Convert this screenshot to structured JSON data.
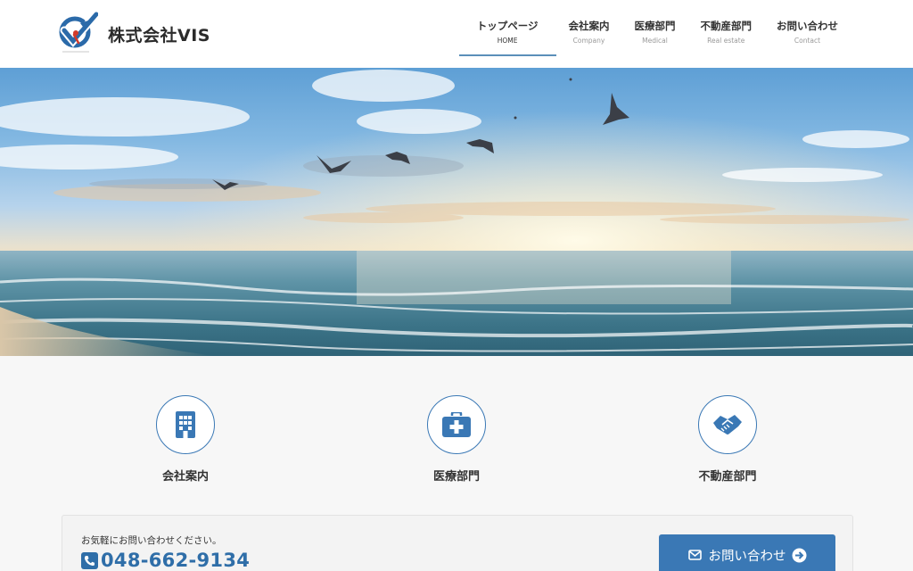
{
  "header": {
    "company_name": "株式会社VIS",
    "nav": [
      {
        "jp": "トップページ",
        "en": "HOME",
        "active": true
      },
      {
        "jp": "会社案内",
        "en": "Company"
      },
      {
        "jp": "医療部門",
        "en": "Medical"
      },
      {
        "jp": "不動産部門",
        "en": "Real estate"
      },
      {
        "jp": "お問い合わせ",
        "en": "Contact"
      }
    ]
  },
  "features": [
    {
      "label": "会社案内",
      "icon": "building-icon"
    },
    {
      "label": "医療部門",
      "icon": "medical-kit-icon"
    },
    {
      "label": "不動産部門",
      "icon": "handshake-icon"
    }
  ],
  "contact": {
    "note": "お気軽にお問い合わせください。",
    "phone": "048-662-9134",
    "button_label": "お問い合わせ",
    "phone_icon": "phone-square-icon",
    "mail_icon": "envelope-icon",
    "arrow_icon": "arrow-circle-right-icon"
  },
  "colors": {
    "accent": "#3a78b5",
    "phone_text": "#2f6ea8",
    "nav_underline": "#5b8fb9"
  }
}
